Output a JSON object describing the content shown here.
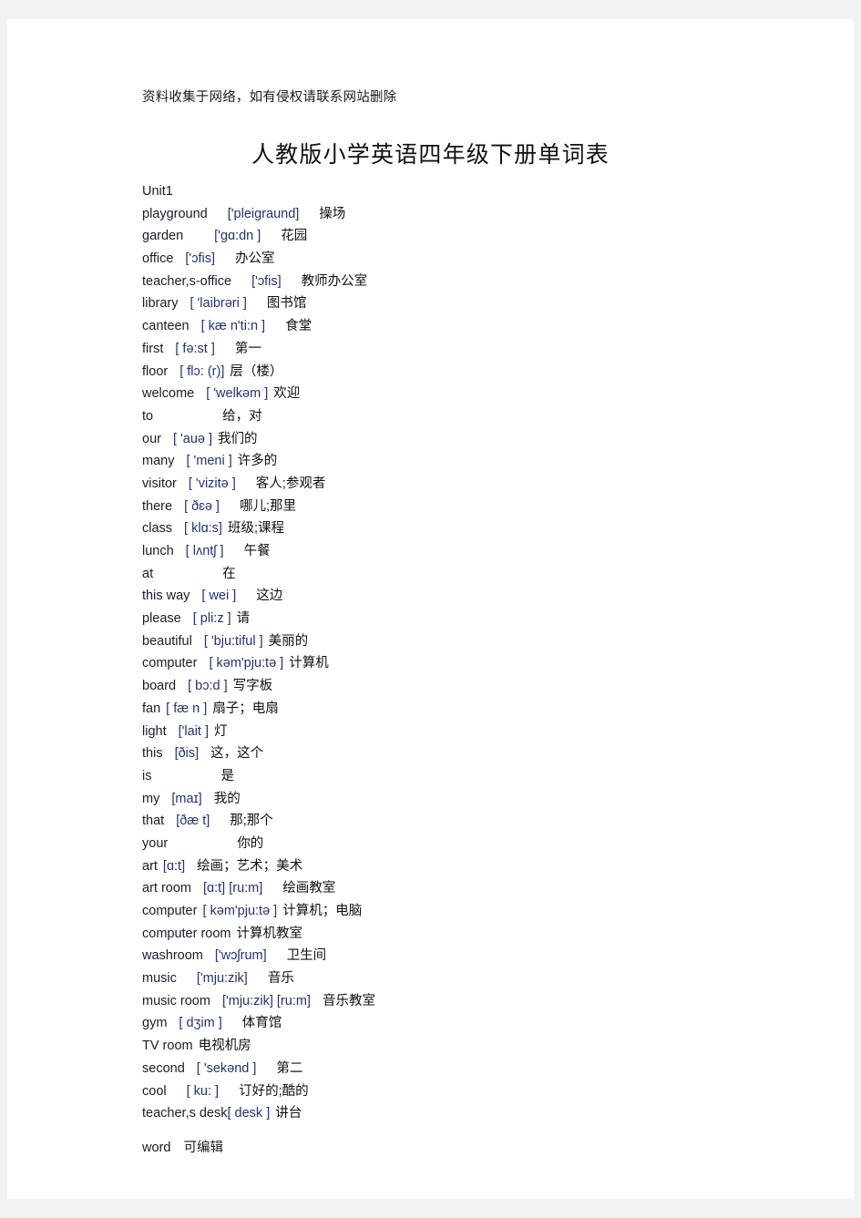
{
  "header": {
    "note": "资料收集于网络，如有侵权请联系网站删除"
  },
  "title": "人教版小学英语四年级下册单词表",
  "unit_label": "Unit1",
  "entries": [
    {
      "word": "playground",
      "phonetic": "['pleiɡraund]",
      "meaning": "操场",
      "gap1": "sp3",
      "gap2": "sp3"
    },
    {
      "word": "garden",
      "phonetic": "['ɡɑ:dn ]",
      "meaning": "花园",
      "gap1": "sp4",
      "gap2": "sp3"
    },
    {
      "word": "office",
      "phonetic": "['ɔfis]",
      "meaning": "办公室",
      "gap1": "sp2",
      "gap2": "sp3"
    },
    {
      "word": "teacher,s-office",
      "phonetic": "['ɔfis]",
      "meaning": "教师办公室",
      "gap1": "sp3",
      "gap2": "sp3"
    },
    {
      "word": "library",
      "phonetic": "[ 'laibrəri ]",
      "meaning": "图书馆",
      "gap1": "sp2",
      "gap2": "sp3"
    },
    {
      "word": "canteen",
      "phonetic": "[ kæ n'ti:n ]",
      "meaning": "食堂",
      "gap1": "sp2",
      "gap2": "sp3"
    },
    {
      "word": "first",
      "phonetic": "[ fə:st ]",
      "meaning": "第一",
      "gap1": "sp2",
      "gap2": "sp3"
    },
    {
      "word": "floor",
      "phonetic": "[ flɔ: (r)]",
      "meaning": "层（楼）",
      "gap1": "sp2",
      "gap2": "sp1"
    },
    {
      "word": "welcome",
      "phonetic": "[ 'welkəm ]",
      "meaning": "欢迎",
      "gap1": "sp2",
      "gap2": "sp1"
    },
    {
      "word": "to",
      "phonetic": "",
      "meaning": "给，对",
      "gap1": "sp6",
      "gap2": "sp1"
    },
    {
      "word": "our",
      "phonetic": "[ 'auə ]",
      "meaning": "我们的",
      "gap1": "sp2",
      "gap2": "sp1"
    },
    {
      "word": "many",
      "phonetic": "[ 'meni ]",
      "meaning": "许多的",
      "gap1": "sp2",
      "gap2": "sp1"
    },
    {
      "word": "visitor",
      "phonetic": "[ 'vizitə ]",
      "meaning": "客人;参观者",
      "gap1": "sp2",
      "gap2": "sp3"
    },
    {
      "word": "there",
      "phonetic": "[ ðɛə ]",
      "meaning": "哪儿;那里",
      "gap1": "sp2",
      "gap2": "sp3"
    },
    {
      "word": "class",
      "phonetic": "[ klɑ:s]",
      "meaning": "班级;课程",
      "gap1": "sp2",
      "gap2": "sp1"
    },
    {
      "word": "lunch",
      "phonetic": "[ lʌntʃ ]",
      "meaning": "午餐",
      "gap1": "sp2",
      "gap2": "sp3"
    },
    {
      "word": "at",
      "phonetic": "",
      "meaning": "在",
      "gap1": "sp6",
      "gap2": "sp4"
    },
    {
      "word": "this  way",
      "phonetic": "[ wei ]",
      "meaning": "这边",
      "gap1": "sp2",
      "gap2": "sp3"
    },
    {
      "word": "please",
      "phonetic": "[ pli:z ]",
      "meaning": "请",
      "gap1": "sp2",
      "gap2": "sp1"
    },
    {
      "word": "beautiful",
      "phonetic": "[ 'bju:tiful ]",
      "meaning": "美丽的",
      "gap1": "sp2",
      "gap2": "sp1"
    },
    {
      "word": "computer",
      "phonetic": "[ kəm'pju:tə ]",
      "meaning": "计算机",
      "gap1": "sp2",
      "gap2": "sp1"
    },
    {
      "word": "board",
      "phonetic": "[ bɔ:d ]",
      "meaning": "写字板",
      "gap1": "sp2",
      "gap2": "sp1"
    },
    {
      "word": "fan",
      "phonetic": "[ fæ n ]",
      "meaning": "扇子；电扇",
      "gap1": "sp1",
      "gap2": "sp1"
    },
    {
      "word": "light",
      "phonetic": "['lait ]",
      "meaning": "灯",
      "gap1": "sp2",
      "gap2": "sp1"
    },
    {
      "word": "this",
      "phonetic": "[ðis]",
      "meaning": "这，这个",
      "gap1": "sp2",
      "gap2": "sp2"
    },
    {
      "word": "is",
      "phonetic": "",
      "meaning": "是",
      "gap1": "sp6",
      "gap2": "sp3"
    },
    {
      "word": "my",
      "phonetic": "[maɪ]",
      "meaning": "我的",
      "gap1": "sp2",
      "gap2": "sp2"
    },
    {
      "word": "that",
      "phonetic": "[ðæ t]",
      "meaning": "那;那个",
      "gap1": "sp2",
      "gap2": "sp3"
    },
    {
      "word": "your",
      "phonetic": "",
      "meaning": "你的",
      "gap1": "sp6",
      "gap2": "sp5"
    },
    {
      "word": "art",
      "phonetic": "[ɑ:t]",
      "meaning": "绘画；艺术；美术",
      "gap1": "sp1",
      "gap2": "sp2"
    },
    {
      "word": "art  room",
      "phonetic": "[ɑ:t] [ru:m]",
      "meaning": "绘画教室",
      "gap1": "sp2",
      "gap2": "sp3"
    },
    {
      "word": "computer",
      "phonetic": "[ kəm'pju:tə ]",
      "meaning": "计算机；电脑",
      "gap1": "sp1",
      "gap2": "sp1"
    },
    {
      "word": "computer  room",
      "phonetic": "",
      "meaning": "计算机教室",
      "gap1": "sp1",
      "gap2": "sp2"
    },
    {
      "word": "washroom",
      "phonetic": "['wɔʃrum]",
      "meaning": "卫生间",
      "gap1": "sp2",
      "gap2": "sp3"
    },
    {
      "word": "music",
      "phonetic": "['mju:zik]",
      "meaning": "音乐",
      "gap1": "sp3",
      "gap2": "sp3"
    },
    {
      "word": "music  room",
      "phonetic": "['mju:zik] [ru:m]",
      "meaning": "音乐教室",
      "gap1": "sp2",
      "gap2": "sp2"
    },
    {
      "word": "gym",
      "phonetic": "[ dʒim ]",
      "meaning": "体育馆",
      "gap1": "sp2",
      "gap2": "sp3"
    },
    {
      "word": "TV  room",
      "phonetic": "",
      "meaning": "电视机房",
      "gap1": "sp1",
      "gap2": "sp1"
    },
    {
      "word": "second",
      "phonetic": "[ 'sekənd ]",
      "meaning": "第二",
      "gap1": "sp2",
      "gap2": "sp3"
    },
    {
      "word": "cool",
      "phonetic": "[ ku: ]",
      "meaning": "订好的;酷的",
      "gap1": "sp3",
      "gap2": "sp3"
    },
    {
      "word": "teacher,s  desk",
      "phonetic": "[ desk ]",
      "meaning": "讲台",
      "gap1": "sp0",
      "gap2": "sp1"
    }
  ],
  "footer": {
    "text_en": "word",
    "text_cn": "可编辑"
  }
}
